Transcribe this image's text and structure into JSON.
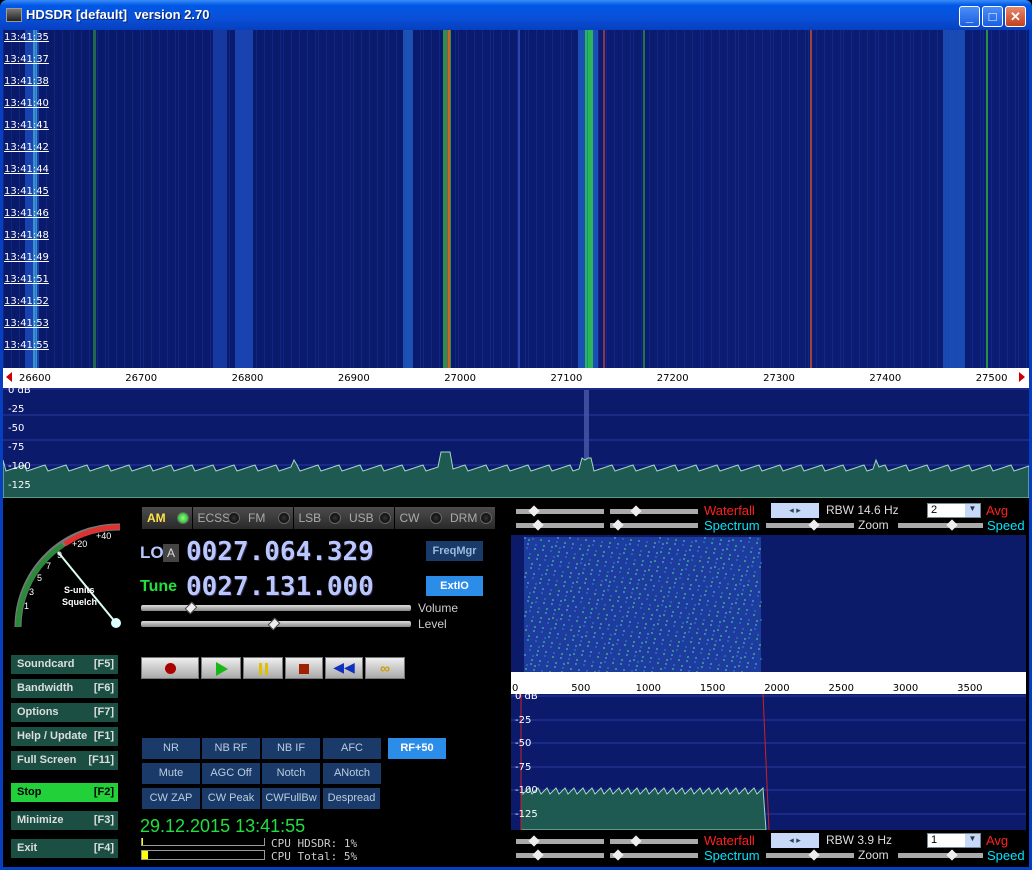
{
  "window": {
    "title": "HDSDR [default]  version 2.70",
    "minimize": "_",
    "maximize": "□",
    "close": "✕"
  },
  "waterfall": {
    "times": [
      "13:41:35",
      "13:41:37",
      "13:41:38",
      "13:41:40",
      "13:41:41",
      "13:41:42",
      "13:41:44",
      "13:41:45",
      "13:41:46",
      "13:41:48",
      "13:41:49",
      "13:41:51",
      "13:41:52",
      "13:41:53",
      "13:41:55"
    ]
  },
  "freq_axis": {
    "labels": [
      "26600",
      "26700",
      "26800",
      "26900",
      "27000",
      "27100",
      "27200",
      "27300",
      "27400",
      "27500"
    ]
  },
  "spectrum": {
    "db_labels": [
      "0 dB",
      "-25",
      "-50",
      "-75",
      "-100",
      "-125"
    ]
  },
  "modes": [
    {
      "label": "AM",
      "active": true
    },
    {
      "label": "ECSS"
    },
    {
      "label": "FM"
    },
    {
      "label": "LSB"
    },
    {
      "label": "USB"
    },
    {
      "label": "CW"
    },
    {
      "label": "DRM"
    }
  ],
  "lo": {
    "label": "LO",
    "tag": "A",
    "value": "0027.064.329"
  },
  "tune": {
    "label": "Tune",
    "value": "0027.131.000"
  },
  "buttons": {
    "freqmgr": "FreqMgr",
    "extio": "ExtIO",
    "volume": "Volume",
    "level": "Level"
  },
  "smeter": {
    "labels": [
      "1",
      "3",
      "5",
      "7",
      "9",
      "+20",
      "+40"
    ],
    "caption1": "S-units",
    "caption2": "Squelch"
  },
  "side": [
    {
      "label": "Soundcard",
      "key": "[F5]"
    },
    {
      "label": "Bandwidth",
      "key": "[F6]"
    },
    {
      "label": "Options",
      "key": "[F7]"
    },
    {
      "label": "Help / Update",
      "key": "[F1]"
    },
    {
      "label": "Full Screen",
      "key": "[F11]"
    },
    {
      "label": "Stop",
      "key": "[F2]"
    },
    {
      "label": "Minimize",
      "key": "[F3]"
    },
    {
      "label": "Exit",
      "key": "[F4]"
    }
  ],
  "func": [
    "NR",
    "NB RF",
    "NB IF",
    "AFC",
    "RF+50",
    "Mute",
    "AGC Off",
    "Notch",
    "ANotch",
    "CW ZAP",
    "CW Peak",
    "CWFullBw",
    "Despread"
  ],
  "datetime": "29.12.2015 13:41:55",
  "cpu": {
    "hdsdr": "CPU HDSDR: 1%",
    "total": "CPU Total: 5%",
    "hdsdr_level": 0.01,
    "total_level": 0.05
  },
  "right_top": {
    "waterfall": "Waterfall",
    "spectrum": "Spectrum",
    "rbw": "RBW 14.6 Hz",
    "avg": "2",
    "avg_label": "Avg",
    "zoom": "Zoom",
    "speed": "Speed"
  },
  "right_bottom": {
    "waterfall": "Waterfall",
    "spectrum": "Spectrum",
    "rbw": "RBW  3.9 Hz",
    "avg": "1",
    "avg_label": "Avg",
    "zoom": "Zoom",
    "speed": "Speed"
  },
  "af_axis": {
    "labels": [
      "0",
      "500",
      "1000",
      "1500",
      "2000",
      "2500",
      "3000",
      "3500"
    ]
  },
  "af_db_labels": [
    "0 dB",
    "-25",
    "-50",
    "-75",
    "-100",
    "-125"
  ],
  "colors": {
    "accent_green": "#00ff60",
    "mode_active": "#ffe14a",
    "stop_bg": "#22d03a",
    "rf50_bg": "#2c8de8",
    "waterfall_label": "#ff2020",
    "spectrum_label": "#00e4ff",
    "avg_label": "#ff2020",
    "speed_label": "#00e4ff"
  }
}
